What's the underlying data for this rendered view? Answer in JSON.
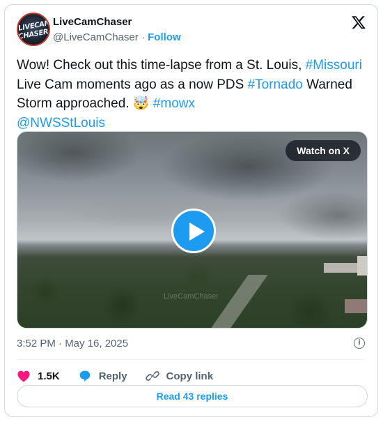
{
  "author": {
    "name": "LiveCamChaser",
    "handle": "@LiveCamChaser",
    "separator": "·",
    "follow_label": "Follow",
    "avatar_text_line1": "LIVECAM",
    "avatar_text_line2": "CHASER"
  },
  "tweet": {
    "part1": "Wow! Check out this time-lapse from a St. Louis, ",
    "tag_missouri": "#Missouri",
    "part2": " Live Cam moments ago as a now PDS ",
    "tag_tornado": "#Tornado",
    "part3": " Warned Storm approached. ",
    "emoji": "🤯",
    "part4": " ",
    "tag_mowx": "#mowx",
    "mention": "@NWSStLouis"
  },
  "media": {
    "watch_label": "Watch on X",
    "watermark": "LiveCamChaser"
  },
  "meta": {
    "timestamp": "3:52 PM · May 16, 2025",
    "info_icon": "i"
  },
  "actions": {
    "likes": "1.5K",
    "reply_label": "Reply",
    "copy_label": "Copy link",
    "read_replies": "Read 43 replies"
  },
  "colors": {
    "accent": "#1d9bf0",
    "heart": "#f91880",
    "text": "#0f1419",
    "muted": "#536471"
  },
  "icons": [
    "x-logo-icon",
    "play-icon",
    "info-icon",
    "heart-icon",
    "reply-icon",
    "link-icon"
  ]
}
